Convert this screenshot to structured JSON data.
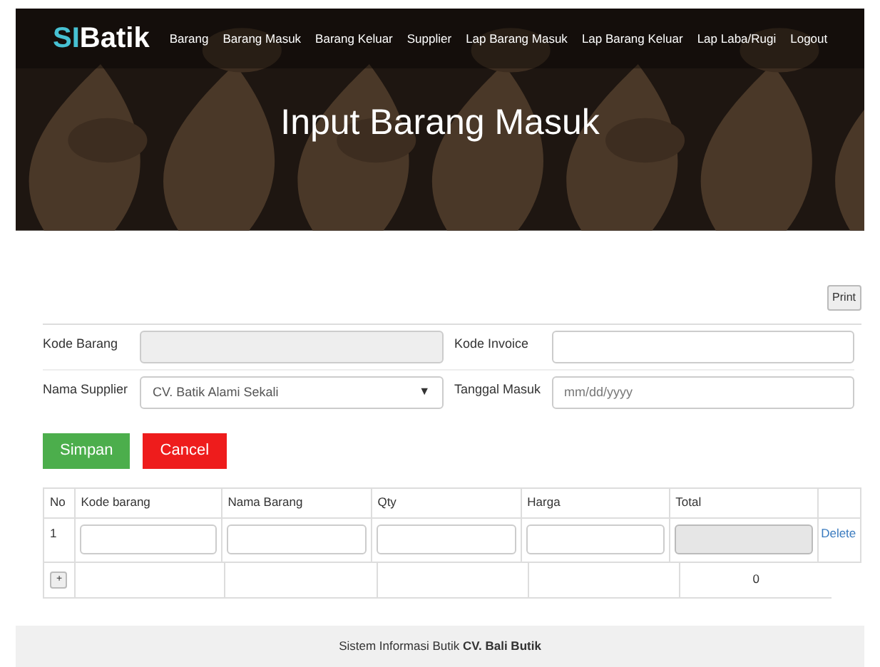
{
  "logo": {
    "prefix": "SI",
    "name": "Batik"
  },
  "nav": [
    {
      "label": "Barang"
    },
    {
      "label": "Barang Masuk"
    },
    {
      "label": "Barang Keluar"
    },
    {
      "label": "Supplier"
    },
    {
      "label": "Lap Barang Masuk"
    },
    {
      "label": "Lap Barang Keluar"
    },
    {
      "label": "Lap Laba/Rugi"
    },
    {
      "label": "Logout"
    }
  ],
  "hero": {
    "title": "Input Barang Masuk",
    "kind": "picture"
  },
  "print_button": "Print",
  "form": [
    {
      "label": "Kode Barang",
      "kind": "text",
      "disabled": true
    },
    {
      "label": "Kode Invoice",
      "kind": "text",
      "disabled": false
    },
    {
      "label": "Nama Supplier",
      "kind": "select",
      "value": "CV. Batik Alami Sekali",
      "caret": "▼",
      "disabled": false
    },
    {
      "label": "Tanggal Masuk",
      "kind": "text",
      "placeholder": "mm/dd/yyyy",
      "disabled": false
    }
  ],
  "buttons": [
    {
      "label": "Simpan",
      "color": "#4cae4c"
    },
    {
      "label": "Cancel",
      "color": "#ee1c1c"
    }
  ],
  "table": {
    "columns": [
      "No",
      "Kode barang",
      "Nama Barang",
      "Qty",
      "Harga",
      "Total"
    ],
    "rows": [
      {
        "no": "1",
        "fields": [
          {
            "disabled": false
          },
          {
            "disabled": false
          },
          {
            "disabled": false
          },
          {
            "disabled": false
          },
          {
            "disabled": true
          }
        ],
        "action": "Delete"
      }
    ],
    "add_button": "+",
    "grand_total": "0"
  },
  "footer": "Sistem Informasi Butik **CV. Bali Butik**"
}
